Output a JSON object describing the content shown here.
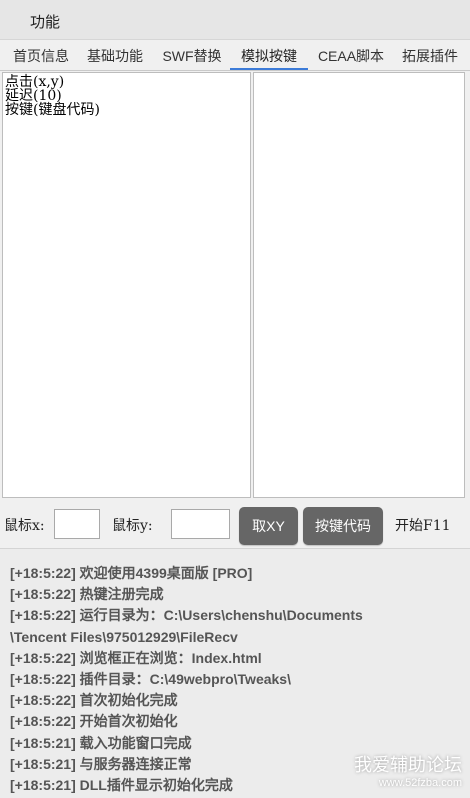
{
  "window": {
    "title": "功能"
  },
  "tabs": [
    {
      "label": "首页信息"
    },
    {
      "label": "基础功能"
    },
    {
      "label": "SWF替换"
    },
    {
      "label": "模拟按键",
      "active": true
    },
    {
      "label": "CEAA脚本"
    },
    {
      "label": "拓展插件"
    }
  ],
  "commands": [
    {
      "text": "点击(x,y)"
    },
    {
      "text": "延迟(10)"
    },
    {
      "text": "按键(键盘代码)"
    }
  ],
  "controls": {
    "mouse_x_label": "鼠标x:",
    "mouse_x_value": "",
    "mouse_y_label": "鼠标y:",
    "mouse_y_value": "",
    "get_xy_button": "取XY",
    "key_code_button": "按键代码",
    "start_label": "开始F11"
  },
  "log": [
    "[+18:5:22] 欢迎使用4399桌面版 [PRO]",
    "[+18:5:22] 热键注册完成",
    "[+18:5:22] 运行目录为：C:\\Users\\chenshu\\Documents",
    "\\Tencent Files\\975012929\\FileRecv",
    "[+18:5:22] 浏览框正在浏览：Index.html",
    "[+18:5:22] 插件目录：C:\\49webpro\\Tweaks\\",
    "[+18:5:22] 首次初始化完成",
    "[+18:5:22] 开始首次初始化",
    "[+18:5:21] 载入功能窗口完成",
    "[+18:5:21] 与服务器连接正常",
    "[+18:5:21] DLL插件显示初始化完成"
  ],
  "watermark": {
    "line1": "我爱辅助论坛",
    "line2": "www.52fzba.com"
  },
  "colors": {
    "accent": "#3c7bd8",
    "button_bg": "#666666",
    "log_text": "#555555"
  }
}
